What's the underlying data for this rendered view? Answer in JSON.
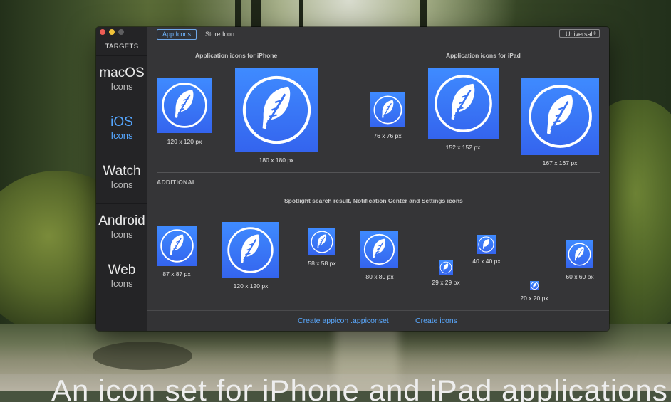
{
  "caption": "An icon set for iPhone and iPad applications",
  "sidebar": {
    "title": "TARGETS",
    "items": [
      {
        "name": "macOS",
        "sub": "Icons"
      },
      {
        "name": "iOS",
        "sub": "Icons"
      },
      {
        "name": "Watch",
        "sub": "Icons"
      },
      {
        "name": "Android",
        "sub": "Icons"
      },
      {
        "name": "Web",
        "sub": "Icons"
      }
    ],
    "active": "iOS"
  },
  "tabs": [
    {
      "label": "App Icons",
      "active": true
    },
    {
      "label": "Store Icon",
      "active": false
    }
  ],
  "platform_select": "Universal",
  "sections": {
    "iphone_title": "Application icons for iPhone",
    "ipad_title": "Application icons for iPad",
    "additional_label": "ADDITIONAL",
    "spotlight_title": "Spotlight search result, Notification Center and Settings icons"
  },
  "icons": {
    "iphone": [
      "120 x 120 px",
      "180 x 180 px"
    ],
    "ipad": [
      "76 x 76 px",
      "152 x 152 px",
      "167 x 167 px"
    ],
    "additional": [
      "87 x 87 px",
      "120 x 120 px",
      "58 x 58 px",
      "80 x 80 px",
      "29 x 29 px",
      "40 x 40 px",
      "20 x 20 px",
      "60 x 60 px"
    ]
  },
  "footer": {
    "create_appiconset": "Create appicon .appiconset",
    "create_icons": "Create icons"
  },
  "icon_glyph": "feather-icon",
  "colors": {
    "accent": "#55a6ff",
    "icon_blue": "#3a74f4"
  }
}
